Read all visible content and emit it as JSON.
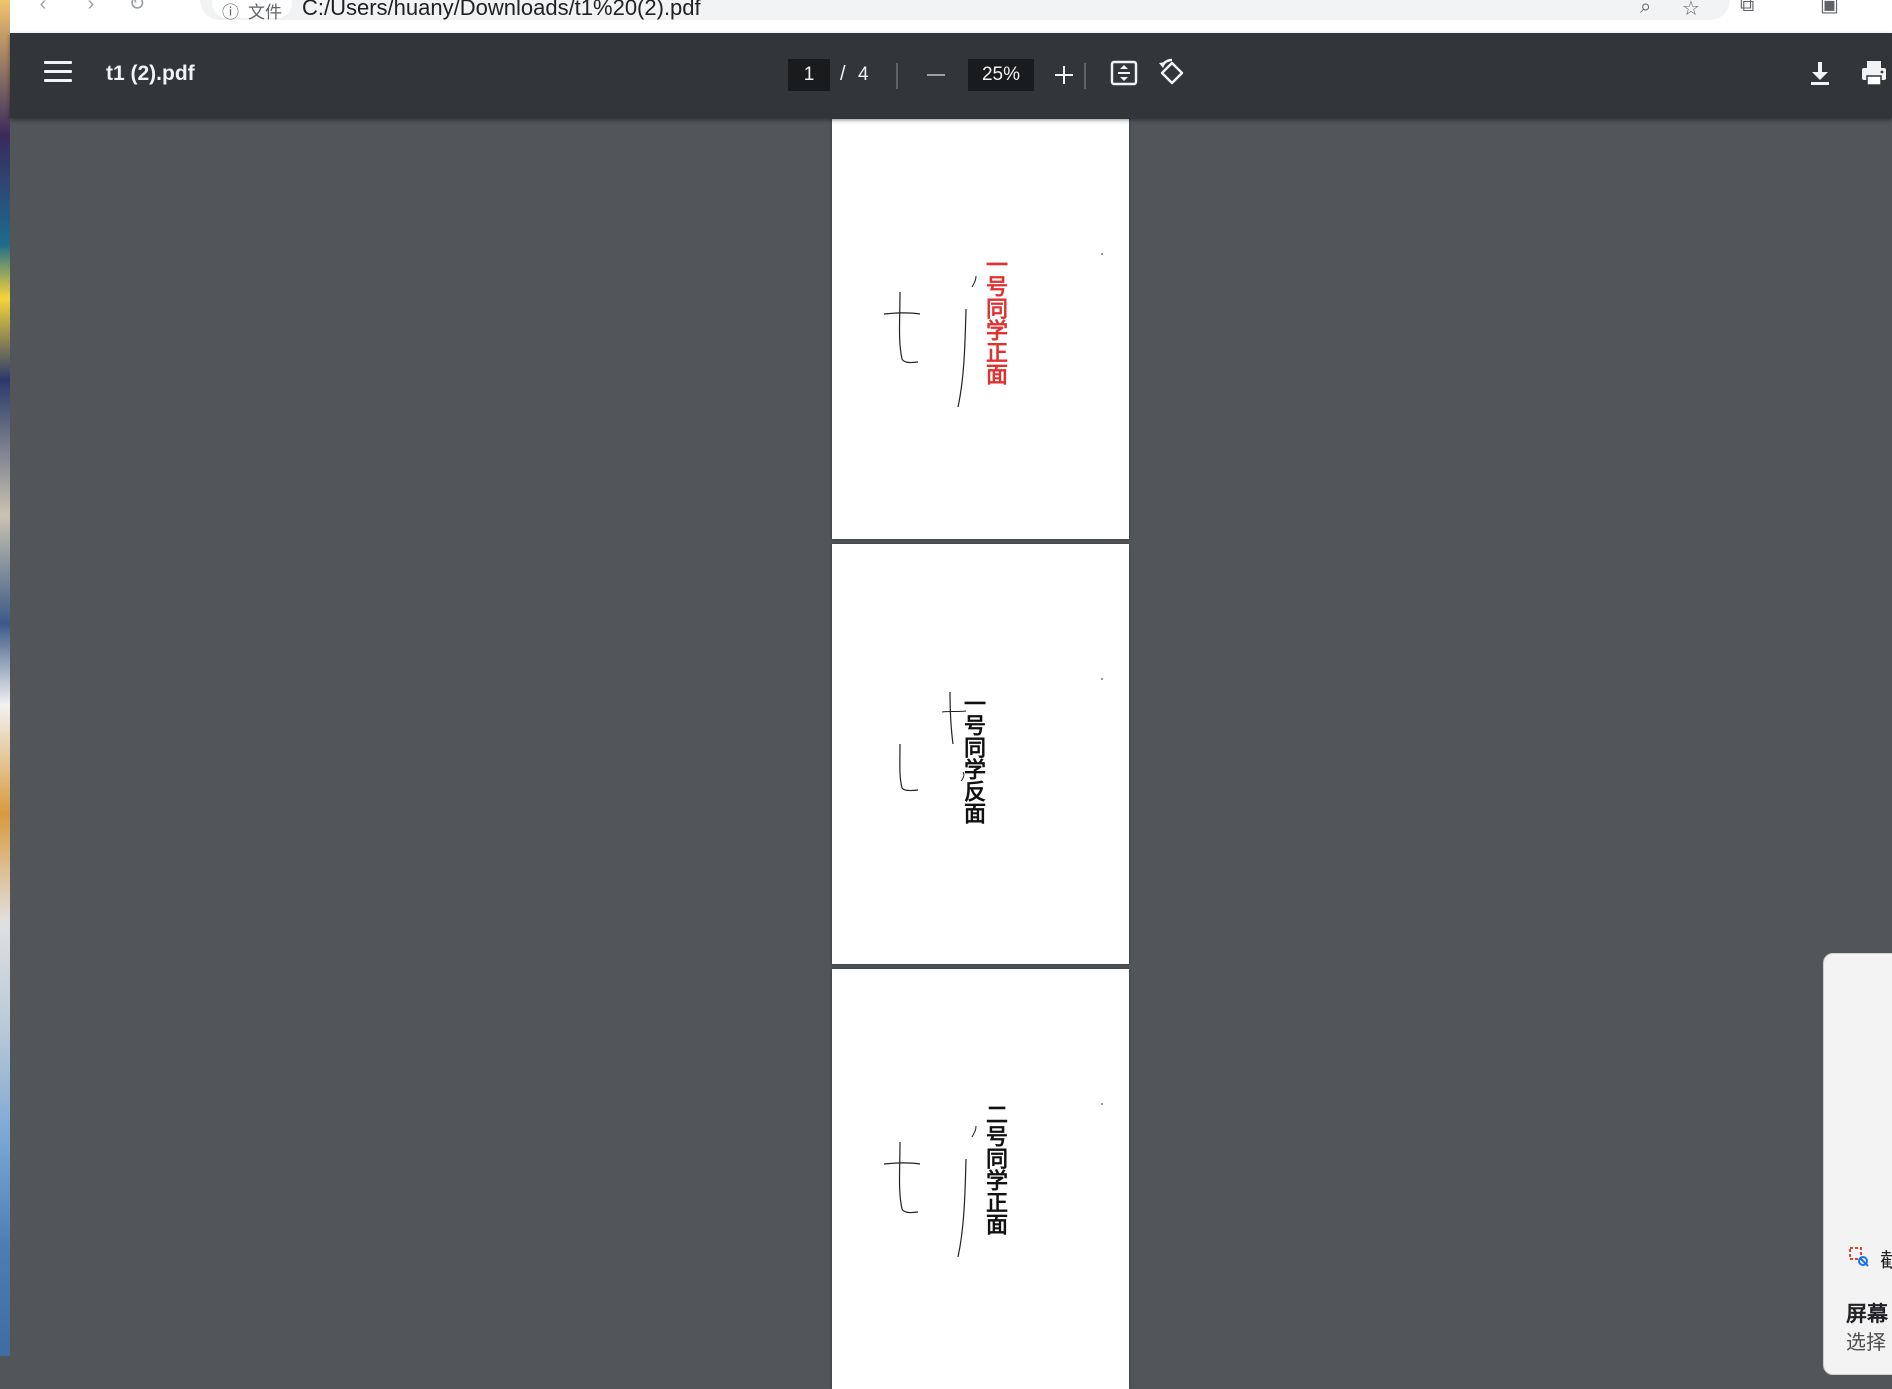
{
  "browser": {
    "address_prefix": "文件",
    "url": "C:/Users/huany/Downloads/t1%20(2).pdf"
  },
  "toolbar": {
    "title": "t1 (2).pdf",
    "page_current": "1",
    "page_separator": "/",
    "page_total": "4",
    "zoom": "25%",
    "icons": [
      "menu-icon",
      "zoom-out-icon",
      "zoom-in-icon",
      "fit-to-page-icon",
      "rotate-icon",
      "download-icon",
      "print-icon"
    ]
  },
  "pages": [
    {
      "label": "一号同学正面",
      "color": "#e03131"
    },
    {
      "label": "一号同学反面",
      "color": "#111111"
    },
    {
      "label": "二号同学正面",
      "color": "#111111"
    }
  ],
  "notification": {
    "app": "截",
    "title": "屏幕",
    "body": "选择"
  },
  "colors": {
    "toolbar_bg": "#323639",
    "viewer_bg": "#525659",
    "page_bg": "#ffffff"
  }
}
